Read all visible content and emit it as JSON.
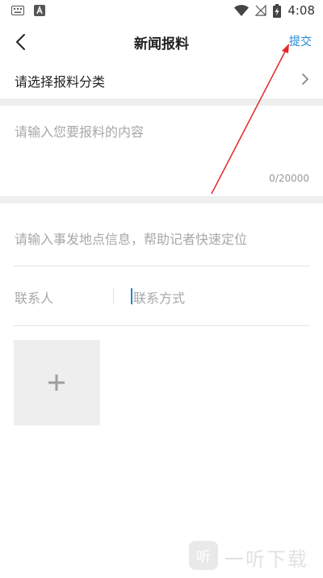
{
  "status_bar": {
    "time": "4:08",
    "left_icons": [
      "keyboard-icon",
      "a-icon"
    ],
    "right_icons": [
      "wifi-icon",
      "no-signal-icon",
      "battery-charging-icon"
    ]
  },
  "header": {
    "title": "新闻报料",
    "submit_label": "提交"
  },
  "category": {
    "label": "请选择报料分类"
  },
  "content": {
    "placeholder": "请输入您要报料的内容",
    "char_count": "0/20000"
  },
  "location": {
    "placeholder": "请输入事发地点信息，帮助记者快速定位"
  },
  "contact": {
    "name_placeholder": "联系人",
    "method_placeholder": "联系方式"
  },
  "watermark": {
    "text": "一听下载"
  },
  "colors": {
    "accent": "#1e88d6",
    "annotation": "#e3262a",
    "placeholder": "#a8a8a8",
    "divider": "#efefef"
  }
}
